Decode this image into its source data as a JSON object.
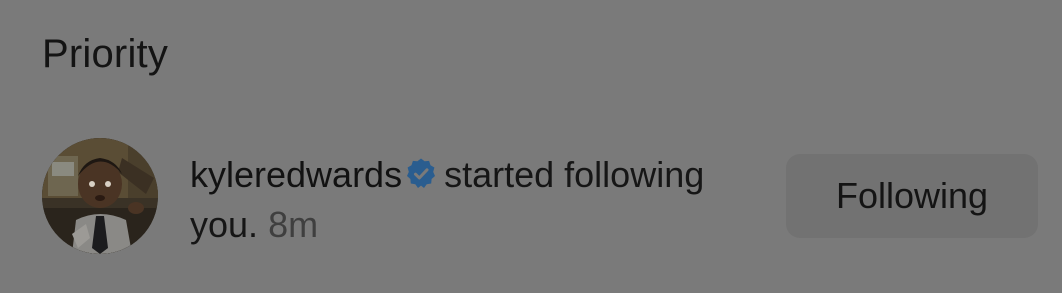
{
  "section": {
    "title": "Priority"
  },
  "notification": {
    "username": "kyleredwards",
    "message": "started following you.",
    "timestamp": "8m",
    "button_label": "Following",
    "verified_color": "#2a5d8f"
  },
  "icons": {
    "verified": "verified-badge-icon",
    "avatar": "user-avatar-photo"
  }
}
